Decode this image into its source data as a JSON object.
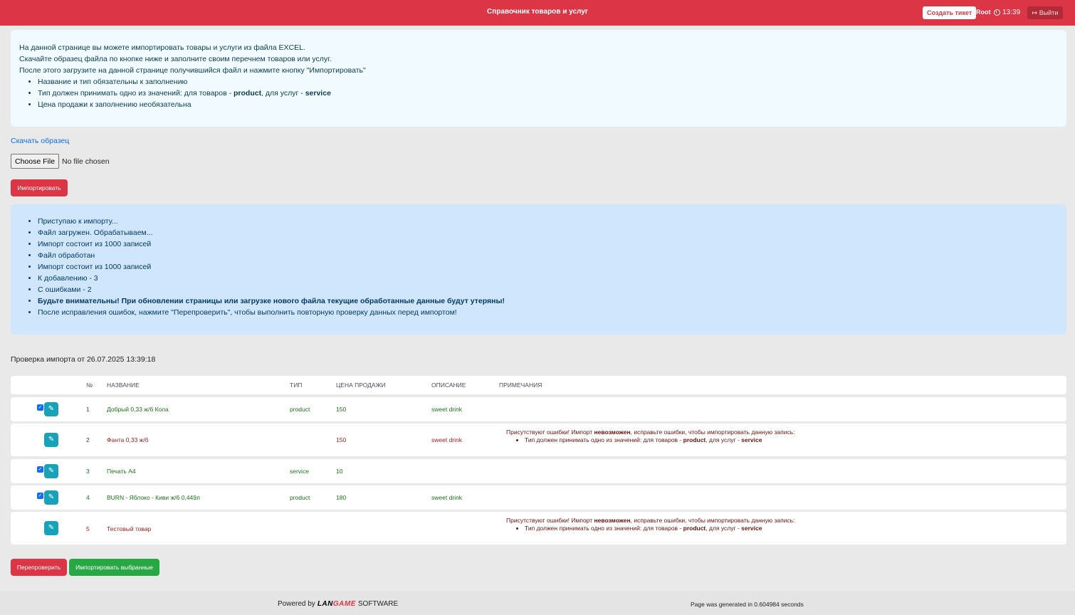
{
  "header": {
    "title": "Справочник товаров и услуг",
    "create_ticket": "Создать тикет",
    "user": "Root",
    "time": "13:39",
    "logout": "Выйти"
  },
  "info": {
    "line1": "На данной странице вы можете импортировать товары и услуги из файла EXCEL.",
    "line2": "Скачайте образец файла по кнопке ниже и заполните своим перечнем товаров или услуг.",
    "line3": "После этого загрузите на данной странице получившийся файл и нажмите кнопку \"Импортировать\"",
    "bullet1": "Название и тип обязательны к заполнению",
    "bullet2_prefix": "Тип должен принимать одно из значений: для товаров - ",
    "bullet2_product": "product",
    "bullet2_mid": ", для услуг - ",
    "bullet2_service": "service",
    "bullet3": "Цена продажи к заполнению необязательна"
  },
  "download_link": "Скачать образец",
  "file_input": {
    "button": "Choose File",
    "status": "No file chosen"
  },
  "import_button": "Импортировать",
  "log": [
    "Приступаю к импорту...",
    "Файл загружен. Обрабатываем...",
    "Импорт состоит из 1000 записей",
    "Файл обработан",
    "Импорт состоит из 1000 записей",
    "К добавлению - 3",
    "С ошибками - 2",
    "Будьте внимательны! При обновлении страницы или загрузке нового файла текущие обработанные данные будут утеряны!",
    "После исправления ошибок, нажмите \"Перепроверить\", чтобы выполнить повторную проверку данных перед импортом!"
  ],
  "check_title": "Проверка импорта от 26.07.2025 13:39:18",
  "table": {
    "headers": {
      "num": "№",
      "name": "НАЗВАНИЕ",
      "type": "ТИП",
      "price": "ЦЕНА ПРОДАЖИ",
      "desc": "ОПИСАНИЕ",
      "notes": "ПРИМЕЧАНИЯ"
    },
    "rows": [
      {
        "num": "1",
        "name": "Добрый 0,33 ж/б Кола",
        "type": "product",
        "price": "150",
        "desc": "sweet drink",
        "checked": true,
        "error": false
      },
      {
        "num": "2",
        "name": "Фанта 0,33 ж/б",
        "type": "",
        "price": "150",
        "desc": "sweet drink",
        "checked": false,
        "error": true
      },
      {
        "num": "3",
        "name": "Печать А4",
        "type": "service",
        "price": "10",
        "desc": "",
        "checked": true,
        "error": false
      },
      {
        "num": "4",
        "name": "BURN - Яблоко - Киви ж/б 0,449л",
        "type": "product",
        "price": "180",
        "desc": "sweet drink",
        "checked": true,
        "error": false
      },
      {
        "num": "5",
        "name": "Тестовый товар",
        "type": "",
        "price": "",
        "desc": "",
        "checked": false,
        "error": true
      }
    ],
    "error_note": {
      "prefix": "Присутствуют ошибки! Импорт ",
      "bold": "невозможен",
      "suffix": ", исправьте ошибки, чтобы импортировать данную запись:",
      "bullet_prefix": "Тип должен принимать одно из значений: для товаров - ",
      "bullet_product": "product",
      "bullet_mid": ", для услуг - ",
      "bullet_service": "service"
    }
  },
  "buttons": {
    "recheck": "Перепроверить",
    "import_selected": "Импортировать выбранные"
  },
  "footer": {
    "powered": "Powered by",
    "brand_a": "LAN",
    "brand_b": "GAME",
    "brand_suffix": "SOFTWARE",
    "generated": "Page was generated in 0.604984 seconds"
  },
  "colors": {
    "accent": "#dc3545",
    "success": "#28a745",
    "info_bg": "#cfe6fc",
    "edit": "#17a2b8"
  }
}
